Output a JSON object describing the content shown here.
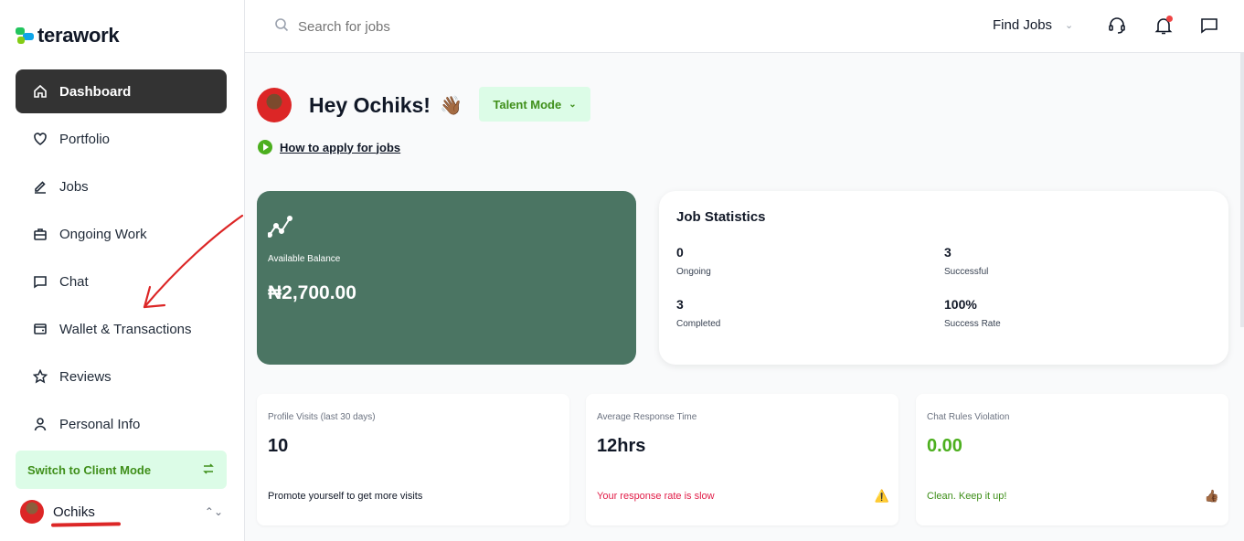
{
  "brand": {
    "name": "terawork"
  },
  "sidebar": {
    "items": [
      {
        "label": "Dashboard",
        "icon": "home-icon",
        "active": true
      },
      {
        "label": "Portfolio",
        "icon": "heart-icon"
      },
      {
        "label": "Jobs",
        "icon": "pen-icon"
      },
      {
        "label": "Ongoing Work",
        "icon": "briefcase-icon"
      },
      {
        "label": "Chat",
        "icon": "message-icon"
      },
      {
        "label": "Wallet & Transactions",
        "icon": "wallet-icon"
      },
      {
        "label": "Reviews",
        "icon": "star-icon"
      },
      {
        "label": "Personal Info",
        "icon": "user-icon"
      }
    ],
    "switch_label": "Switch to Client Mode",
    "user_name": "Ochiks"
  },
  "topbar": {
    "search_placeholder": "Search for jobs",
    "find_jobs": "Find Jobs"
  },
  "main": {
    "greeting": "Hey Ochiks!",
    "wave": "👋🏾",
    "mode_label": "Talent Mode",
    "how_link": "How to apply for jobs",
    "balance": {
      "label": "Available Balance",
      "value": "₦2,700.00"
    },
    "stats": {
      "title": "Job Statistics",
      "ongoing": {
        "value": "0",
        "label": "Ongoing"
      },
      "successful": {
        "value": "3",
        "label": "Successful"
      },
      "completed": {
        "value": "3",
        "label": "Completed"
      },
      "success_rate": {
        "value": "100%",
        "label": "Success Rate"
      }
    },
    "cards": [
      {
        "label": "Profile Visits (last 30 days)",
        "value": "10",
        "footer": "Promote yourself to get more visits"
      },
      {
        "label": "Average Response Time",
        "value": "12hrs",
        "footer": "Your response rate is slow",
        "emoji": "⚠️"
      },
      {
        "label": "Chat Rules Violation",
        "value": "0.00",
        "footer": "Clean. Keep it up!",
        "emoji": "👍🏾"
      }
    ]
  },
  "colors": {
    "accent_green": "#4caf1e",
    "balance_bg": "#4b7563",
    "active_nav": "#333333",
    "alert_red": "#e11d48"
  }
}
